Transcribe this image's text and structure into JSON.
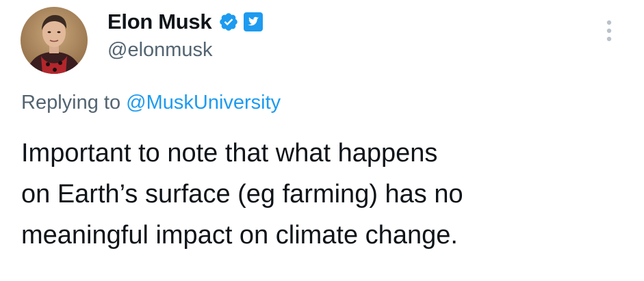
{
  "author": {
    "display_name": "Elon Musk",
    "handle": "@elonmusk",
    "verified_icon": "verified-badge-icon",
    "affiliate_icon": "twitter-affiliate-icon"
  },
  "reply": {
    "prefix": "Replying to ",
    "mention": "@MuskUniversity"
  },
  "tweet": {
    "lines": [
      "Important to note that what happens",
      "on Earth’s surface (eg farming) has no",
      "meaningful impact on climate change."
    ]
  },
  "colors": {
    "accent": "#1d9bf0",
    "text": "#0f1419",
    "secondary_text": "#536471"
  },
  "icons": {
    "more": "more-vertical-icon"
  }
}
